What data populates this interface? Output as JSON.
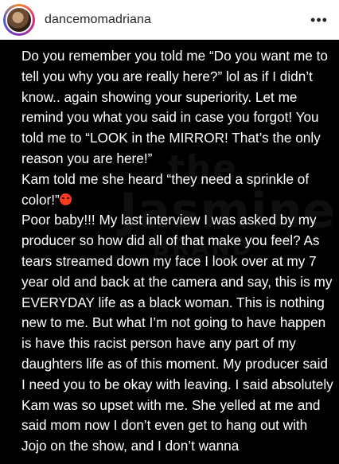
{
  "header": {
    "username": "dancemomadriana",
    "more_glyph": "•••"
  },
  "watermark": {
    "top": "the",
    "main": "Jasmine",
    "sub": "BRAND"
  },
  "post": {
    "paragraphs": [
      "Do you remember you told me “Do you want me to tell you why you are really here?” lol as if I didn’t know.. again showing your superiority. Let me remind you what you said in case you forgot! You told me to “LOOK in the MIRROR! That’s the only reason you are here!”",
      "Kam told me she heard “they need a sprinkle of color!”",
      "Poor baby!!! My last interview I was asked by my producer so how did all of that make you feel? As tears streamed down my face I look over at my 7 year old and back at the camera and say, this is my EVERYDAY life as a black woman. This is nothing new to me. But what I’m not going to have happen is have this racist person have any part of my daughters life as of this moment. My producer said I need you to be okay with leaving. I said absolutely Kam was so upset with me. She yelled at me and said mom now I don’t even get to hang out with Jojo on the show, and I don’t wanna"
    ],
    "emoji_icon": "angry-face-icon"
  },
  "colors": {
    "post_background": "#000000",
    "post_text": "#ffffff",
    "header_text": "#262626"
  }
}
